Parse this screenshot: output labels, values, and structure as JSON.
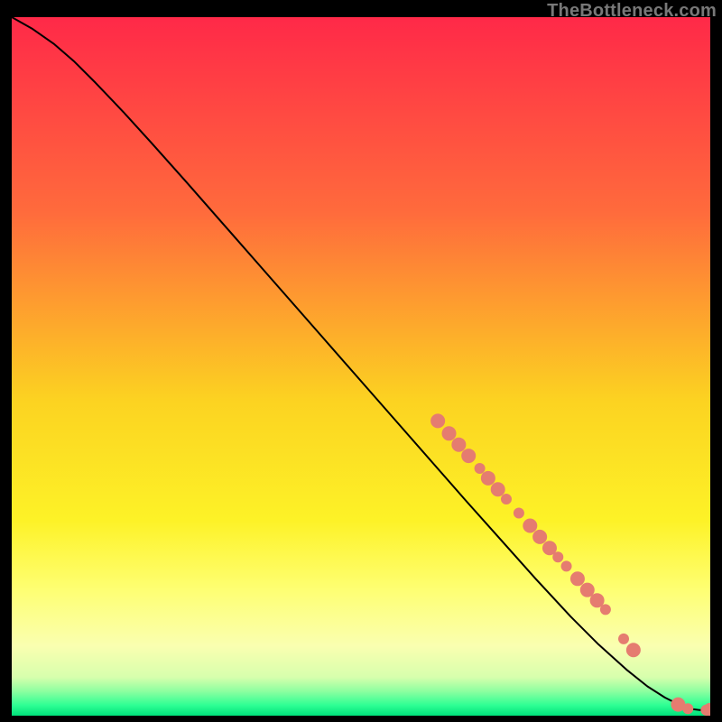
{
  "attribution": "TheBottleneck.com",
  "chart_data": {
    "type": "line",
    "title": "",
    "xlabel": "",
    "ylabel": "",
    "xlim": [
      0,
      100
    ],
    "ylim": [
      0,
      100
    ],
    "background_gradient": [
      {
        "offset": 0.0,
        "color": "#ff2948"
      },
      {
        "offset": 0.28,
        "color": "#ff6b3c"
      },
      {
        "offset": 0.55,
        "color": "#fcd321"
      },
      {
        "offset": 0.72,
        "color": "#fdf227"
      },
      {
        "offset": 0.82,
        "color": "#feff73"
      },
      {
        "offset": 0.9,
        "color": "#faffb0"
      },
      {
        "offset": 0.945,
        "color": "#d7ffad"
      },
      {
        "offset": 0.965,
        "color": "#8dffa0"
      },
      {
        "offset": 0.985,
        "color": "#2eff94"
      },
      {
        "offset": 1.0,
        "color": "#00e07a"
      }
    ],
    "series": [
      {
        "name": "bottleneck-curve",
        "color": "#000000",
        "x": [
          0,
          3,
          6,
          9,
          12,
          16,
          20,
          25,
          30,
          35,
          40,
          45,
          50,
          55,
          60,
          65,
          70,
          75,
          80,
          84,
          88,
          91,
          93.5,
          95.5,
          97,
          98.5,
          100
        ],
        "y": [
          100,
          98.3,
          96.2,
          93.6,
          90.6,
          86.4,
          82.0,
          76.4,
          70.7,
          65.0,
          59.3,
          53.6,
          47.9,
          42.2,
          36.5,
          30.8,
          25.2,
          19.6,
          14.2,
          10.2,
          6.6,
          4.2,
          2.6,
          1.6,
          1.0,
          0.8,
          0.8
        ]
      }
    ],
    "marker_series": {
      "name": "sample-points",
      "color": "#e57c70",
      "radius_major": 8,
      "radius_minor": 6,
      "points": [
        {
          "x": 61.0,
          "y": 42.2,
          "r": "major"
        },
        {
          "x": 62.6,
          "y": 40.4,
          "r": "major"
        },
        {
          "x": 64.0,
          "y": 38.8,
          "r": "major"
        },
        {
          "x": 65.4,
          "y": 37.2,
          "r": "major"
        },
        {
          "x": 67.0,
          "y": 35.4,
          "r": "minor"
        },
        {
          "x": 68.2,
          "y": 34.0,
          "r": "major"
        },
        {
          "x": 69.6,
          "y": 32.4,
          "r": "major"
        },
        {
          "x": 70.8,
          "y": 31.0,
          "r": "minor"
        },
        {
          "x": 72.6,
          "y": 29.0,
          "r": "minor"
        },
        {
          "x": 74.2,
          "y": 27.2,
          "r": "major"
        },
        {
          "x": 75.6,
          "y": 25.6,
          "r": "major"
        },
        {
          "x": 77.0,
          "y": 24.0,
          "r": "major"
        },
        {
          "x": 78.2,
          "y": 22.7,
          "r": "minor"
        },
        {
          "x": 79.4,
          "y": 21.4,
          "r": "minor"
        },
        {
          "x": 81.0,
          "y": 19.6,
          "r": "major"
        },
        {
          "x": 82.4,
          "y": 18.0,
          "r": "major"
        },
        {
          "x": 83.8,
          "y": 16.5,
          "r": "major"
        },
        {
          "x": 85.0,
          "y": 15.2,
          "r": "minor"
        },
        {
          "x": 87.6,
          "y": 11.0,
          "r": "minor"
        },
        {
          "x": 89.0,
          "y": 9.4,
          "r": "major"
        },
        {
          "x": 95.4,
          "y": 1.6,
          "r": "major"
        },
        {
          "x": 96.8,
          "y": 1.0,
          "r": "minor"
        },
        {
          "x": 99.4,
          "y": 0.8,
          "r": "minor"
        },
        {
          "x": 100.0,
          "y": 0.8,
          "r": "major"
        }
      ]
    }
  }
}
